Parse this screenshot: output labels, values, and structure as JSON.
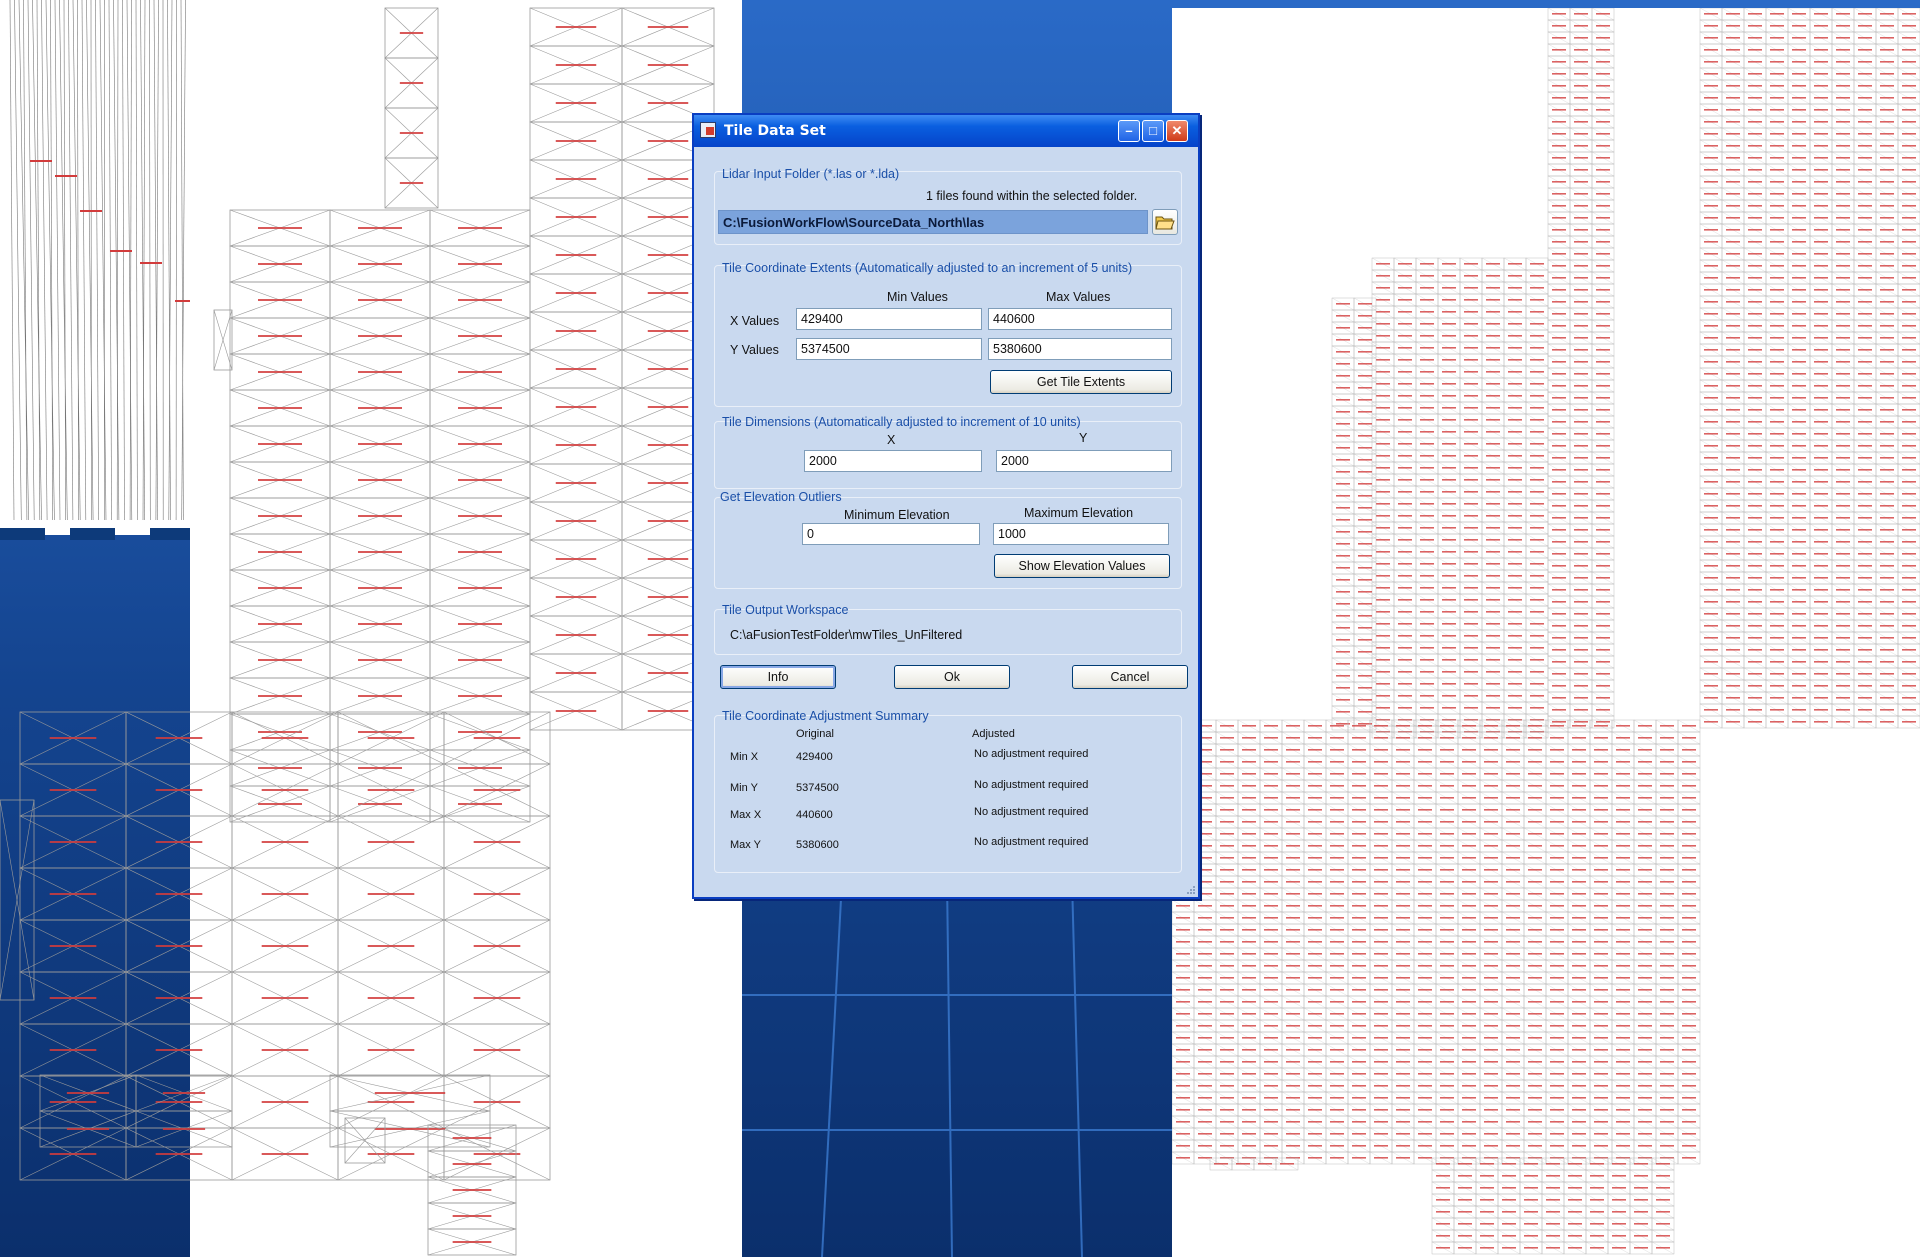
{
  "dialog": {
    "title": "Tile Data Set",
    "lidar": {
      "group_label": "Lidar Input Folder (*.las or *.lda)",
      "files_found": "1 files found within the selected folder.",
      "path": "C:\\FusionWorkFlow\\SourceData_North\\las",
      "browse_icon": "folder-open-icon"
    },
    "extents": {
      "group_label": "Tile Coordinate Extents (Automatically adjusted to an increment of 5 units)",
      "min_header": "Min Values",
      "max_header": "Max Values",
      "x_label": "X Values",
      "y_label": "Y Values",
      "x_min": "429400",
      "x_max": "440600",
      "y_min": "5374500",
      "y_max": "5380600",
      "get_button": "Get Tile Extents"
    },
    "dimensions": {
      "group_label": "Tile Dimensions (Automatically adjusted to increment of 10 units)",
      "x_header": "X",
      "y_header": "Y",
      "x_value": "2000",
      "y_value": "2000"
    },
    "elevation": {
      "group_label": "Get Elevation Outliers",
      "min_header": "Minimum Elevation",
      "max_header": "Maximum Elevation",
      "min_value": "0",
      "max_value": "1000",
      "show_button": "Show Elevation Values"
    },
    "workspace": {
      "group_label": "Tile Output Workspace",
      "path": "C:\\aFusionTestFolder\\mwTiles_UnFiltered"
    },
    "buttons": {
      "info": "Info",
      "ok": "Ok",
      "cancel": "Cancel"
    },
    "summary": {
      "group_label": "Tile Coordinate Adjustment Summary",
      "col_original": "Original",
      "col_adjusted": "Adjusted",
      "rows": [
        {
          "label": "Min X",
          "original": "429400",
          "adjusted": "No adjustment required"
        },
        {
          "label": "Min Y",
          "original": "5374500",
          "adjusted": "No adjustment required"
        },
        {
          "label": "Max X",
          "original": "440600",
          "adjusted": "No adjustment required"
        },
        {
          "label": "Max Y",
          "original": "5380600",
          "adjusted": "No adjustment required"
        }
      ]
    }
  },
  "colors": {
    "slide_blue": "#1b55a8",
    "tile_label_red": "#d23c3c",
    "tile_line_gray": "#9a9a9a",
    "dash_bar": "#0d3a7a"
  }
}
